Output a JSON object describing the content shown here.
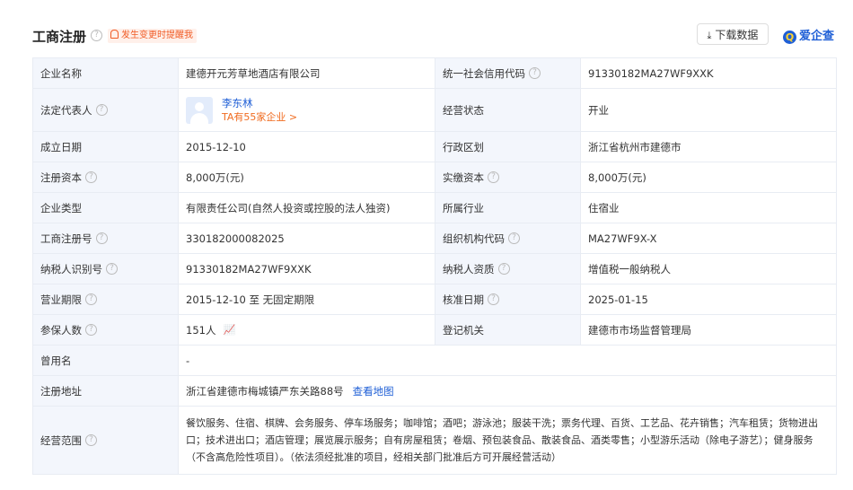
{
  "header": {
    "title": "工商注册",
    "notify_label": "发生变更时提醒我",
    "download_label": "下载数据",
    "logo_text": "爱企查"
  },
  "rows": {
    "company_name": {
      "label": "企业名称",
      "value": "建德开元芳草地酒店有限公司"
    },
    "credit_code": {
      "label": "统一社会信用代码",
      "value": "91330182MA27WF9XXK"
    },
    "legal_rep": {
      "label": "法定代表人",
      "name": "李东林",
      "sub": "TA有55家企业 >"
    },
    "status": {
      "label": "经营状态",
      "value": "开业"
    },
    "found_date": {
      "label": "成立日期",
      "value": "2015-12-10"
    },
    "region": {
      "label": "行政区划",
      "value": "浙江省杭州市建德市"
    },
    "reg_capital": {
      "label": "注册资本",
      "value": "8,000万(元)"
    },
    "paid_capital": {
      "label": "实缴资本",
      "value": "8,000万(元)"
    },
    "company_type": {
      "label": "企业类型",
      "value": "有限责任公司(自然人投资或控股的法人独资)"
    },
    "industry": {
      "label": "所属行业",
      "value": "住宿业"
    },
    "reg_no": {
      "label": "工商注册号",
      "value": "330182000082025"
    },
    "org_code": {
      "label": "组织机构代码",
      "value": "MA27WF9X-X"
    },
    "taxpayer_id": {
      "label": "纳税人识别号",
      "value": "91330182MA27WF9XXK"
    },
    "taxpayer_qual": {
      "label": "纳税人资质",
      "value": "增值税一般纳税人"
    },
    "biz_term": {
      "label": "营业期限",
      "value": "2015-12-10 至 无固定期限"
    },
    "approval_date": {
      "label": "核准日期",
      "value": "2025-01-15"
    },
    "insured": {
      "label": "参保人数",
      "value": "151人"
    },
    "authority": {
      "label": "登记机关",
      "value": "建德市市场监督管理局"
    },
    "former_name": {
      "label": "曾用名",
      "value": "-"
    },
    "address": {
      "label": "注册地址",
      "value": "浙江省建德市梅城镇严东关路88号",
      "link": "查看地图"
    },
    "scope": {
      "label": "经营范围",
      "value": "餐饮服务、住宿、棋牌、会务服务、停车场服务；咖啡馆；酒吧；游泳池；服装干洗；票务代理、百货、工艺品、花卉销售；汽车租赁；货物进出口；技术进出口；酒店管理；展览展示服务；自有房屋租赁；卷烟、预包装食品、散装食品、酒类零售；小型游乐活动（除电子游艺）；健身服务（不含高危险性项目）。（依法须经批准的项目，经相关部门批准后方可开展经营活动）"
    }
  },
  "icons": {
    "help": "question-circle-icon",
    "bell": "bell-icon",
    "download": "download-icon",
    "chart": "line-chart-icon"
  },
  "colors": {
    "accent": "#1f5fd6",
    "warning": "#f05a24",
    "label_bg": "#f3f6fc",
    "border": "#e8ecf3"
  }
}
